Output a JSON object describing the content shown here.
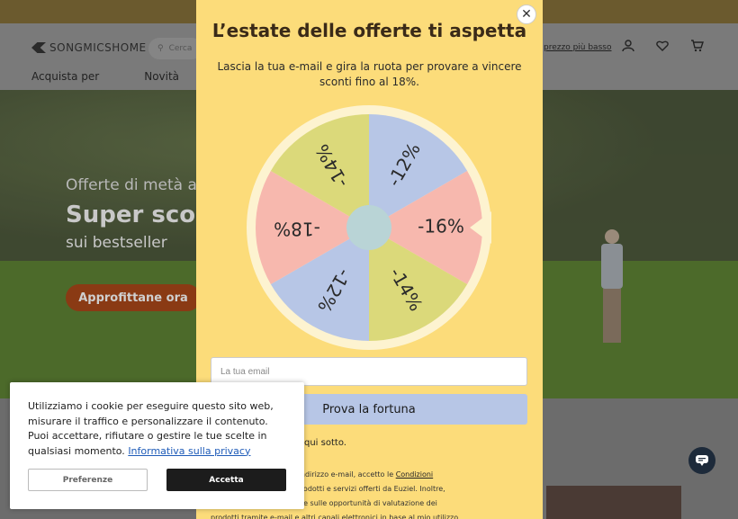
{
  "header": {
    "brand": "SONGMICSHOME",
    "search_placeholder": "Cerca",
    "nav": [
      "Acquista per",
      "Novità"
    ],
    "link": "prezzo più basso"
  },
  "hero": {
    "small": "Offerte di metà an",
    "big": "Super scont",
    "sub": "sui bestseller",
    "cta": "Approfittane ora"
  },
  "modal": {
    "title": "L’estate delle offerte ti aspetta",
    "description": "Lascia la tua e-mail e gira la ruota per provare a vincere sconti fino al 18%.",
    "wheel": {
      "segments": [
        "-12%",
        "-16%",
        "-14%",
        "-12%",
        "-18%",
        "-14%"
      ],
      "colors": {
        "blue": "#b7c6e6",
        "pink": "#f7b8ae",
        "green": "#dbd97a",
        "rim": "#fdf3d0",
        "center": "#b9d4d6"
      }
    },
    "email_placeholder": "La tua email",
    "spin_button": "Prova la fortuna",
    "below_button": "qui sotto.",
    "legal_line1": "privacy. Fornendo il mio indirizzo e-mail, accetto le ",
    "legal_link": "Condizioni",
    "legal_line2": "ro essere informato sui prodotti e servizi offerti da Euziel. Inoltre,",
    "legal_line3": "ioni sulle attività in corso e sulle opportunità di valutazione dei",
    "legal_line4": "prodotti tramite e-mail e altri canali elettronici in base al mio utilizzo."
  },
  "cookie": {
    "text": "Utilizziamo i cookie per eseguire questo sito web, misurare il traffico e personalizzare il contenuto. Puoi accettare, rifiutare o gestire le tue scelte in qualsiasi momento.",
    "privacy_link": "Informativa sulla privacy",
    "preferences": "Preferenze",
    "accept": "Accetta"
  },
  "icons": {
    "close": "close-icon",
    "search": "search-icon",
    "user": "user-icon",
    "heart": "heart-icon",
    "cart": "cart-icon",
    "chat": "chat-icon"
  }
}
